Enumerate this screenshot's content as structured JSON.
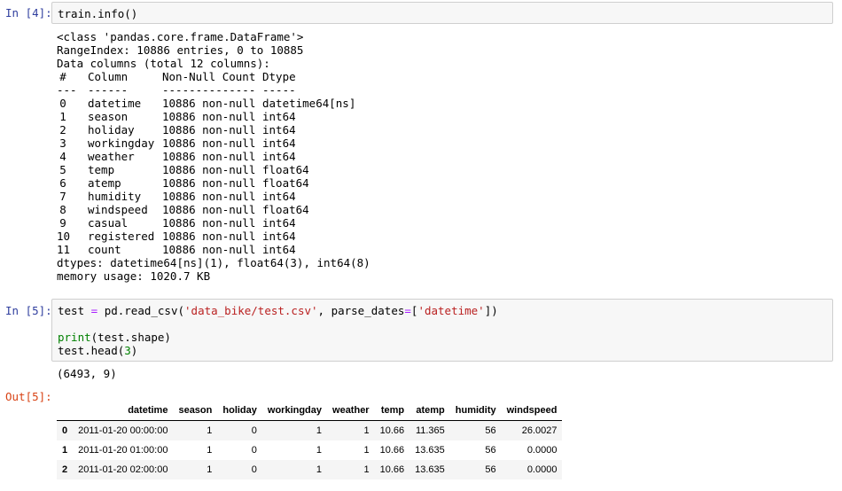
{
  "cells": [
    {
      "prompt": "In [4]:",
      "code": "train.info()",
      "output": {
        "header_lines": [
          "<class 'pandas.core.frame.DataFrame'>",
          "RangeIndex: 10886 entries, 0 to 10885",
          "Data columns (total 12 columns):"
        ],
        "columns_header": [
          "#",
          "Column",
          "Non-Null Count",
          "Dtype"
        ],
        "separators": [
          "---",
          "------",
          "--------------",
          "-----"
        ],
        "rows": [
          [
            "0",
            "datetime",
            "10886 non-null",
            "datetime64[ns]"
          ],
          [
            "1",
            "season",
            "10886 non-null",
            "int64"
          ],
          [
            "2",
            "holiday",
            "10886 non-null",
            "int64"
          ],
          [
            "3",
            "workingday",
            "10886 non-null",
            "int64"
          ],
          [
            "4",
            "weather",
            "10886 non-null",
            "int64"
          ],
          [
            "5",
            "temp",
            "10886 non-null",
            "float64"
          ],
          [
            "6",
            "atemp",
            "10886 non-null",
            "float64"
          ],
          [
            "7",
            "humidity",
            "10886 non-null",
            "int64"
          ],
          [
            "8",
            "windspeed",
            "10886 non-null",
            "float64"
          ],
          [
            "9",
            "casual",
            "10886 non-null",
            "int64"
          ],
          [
            "10",
            "registered",
            "10886 non-null",
            "int64"
          ],
          [
            "11",
            "count",
            "10886 non-null",
            "int64"
          ]
        ],
        "dtypes_line": "dtypes: datetime64[ns](1), float64(3), int64(8)",
        "memory_line": "memory usage: 1020.7 KB"
      }
    },
    {
      "prompt": "In [5]:",
      "code_line1": {
        "a": "test ",
        "op": "=",
        "b": " pd.read_csv(",
        "s1": "'data_bike/test.csv'",
        "c": ", parse_dates",
        "op2": "=",
        "d": "[",
        "s2": "'datetime'",
        "e": "])"
      },
      "code_line2": {
        "kw": "print",
        "rest": "(test.shape)"
      },
      "code_line3": {
        "a": "test.head(",
        "num": "3",
        "b": ")"
      },
      "stdout": "(6493, 9)",
      "out_prompt": "Out[5]:",
      "table": {
        "columns": [
          "",
          "datetime",
          "season",
          "holiday",
          "workingday",
          "weather",
          "temp",
          "atemp",
          "humidity",
          "windspeed"
        ],
        "rows": [
          [
            "0",
            "2011-01-20 00:00:00",
            "1",
            "0",
            "1",
            "1",
            "10.66",
            "11.365",
            "56",
            "26.0027"
          ],
          [
            "1",
            "2011-01-20 01:00:00",
            "1",
            "0",
            "1",
            "1",
            "10.66",
            "13.635",
            "56",
            "0.0000"
          ],
          [
            "2",
            "2011-01-20 02:00:00",
            "1",
            "0",
            "1",
            "1",
            "10.66",
            "13.635",
            "56",
            "0.0000"
          ]
        ]
      }
    }
  ]
}
